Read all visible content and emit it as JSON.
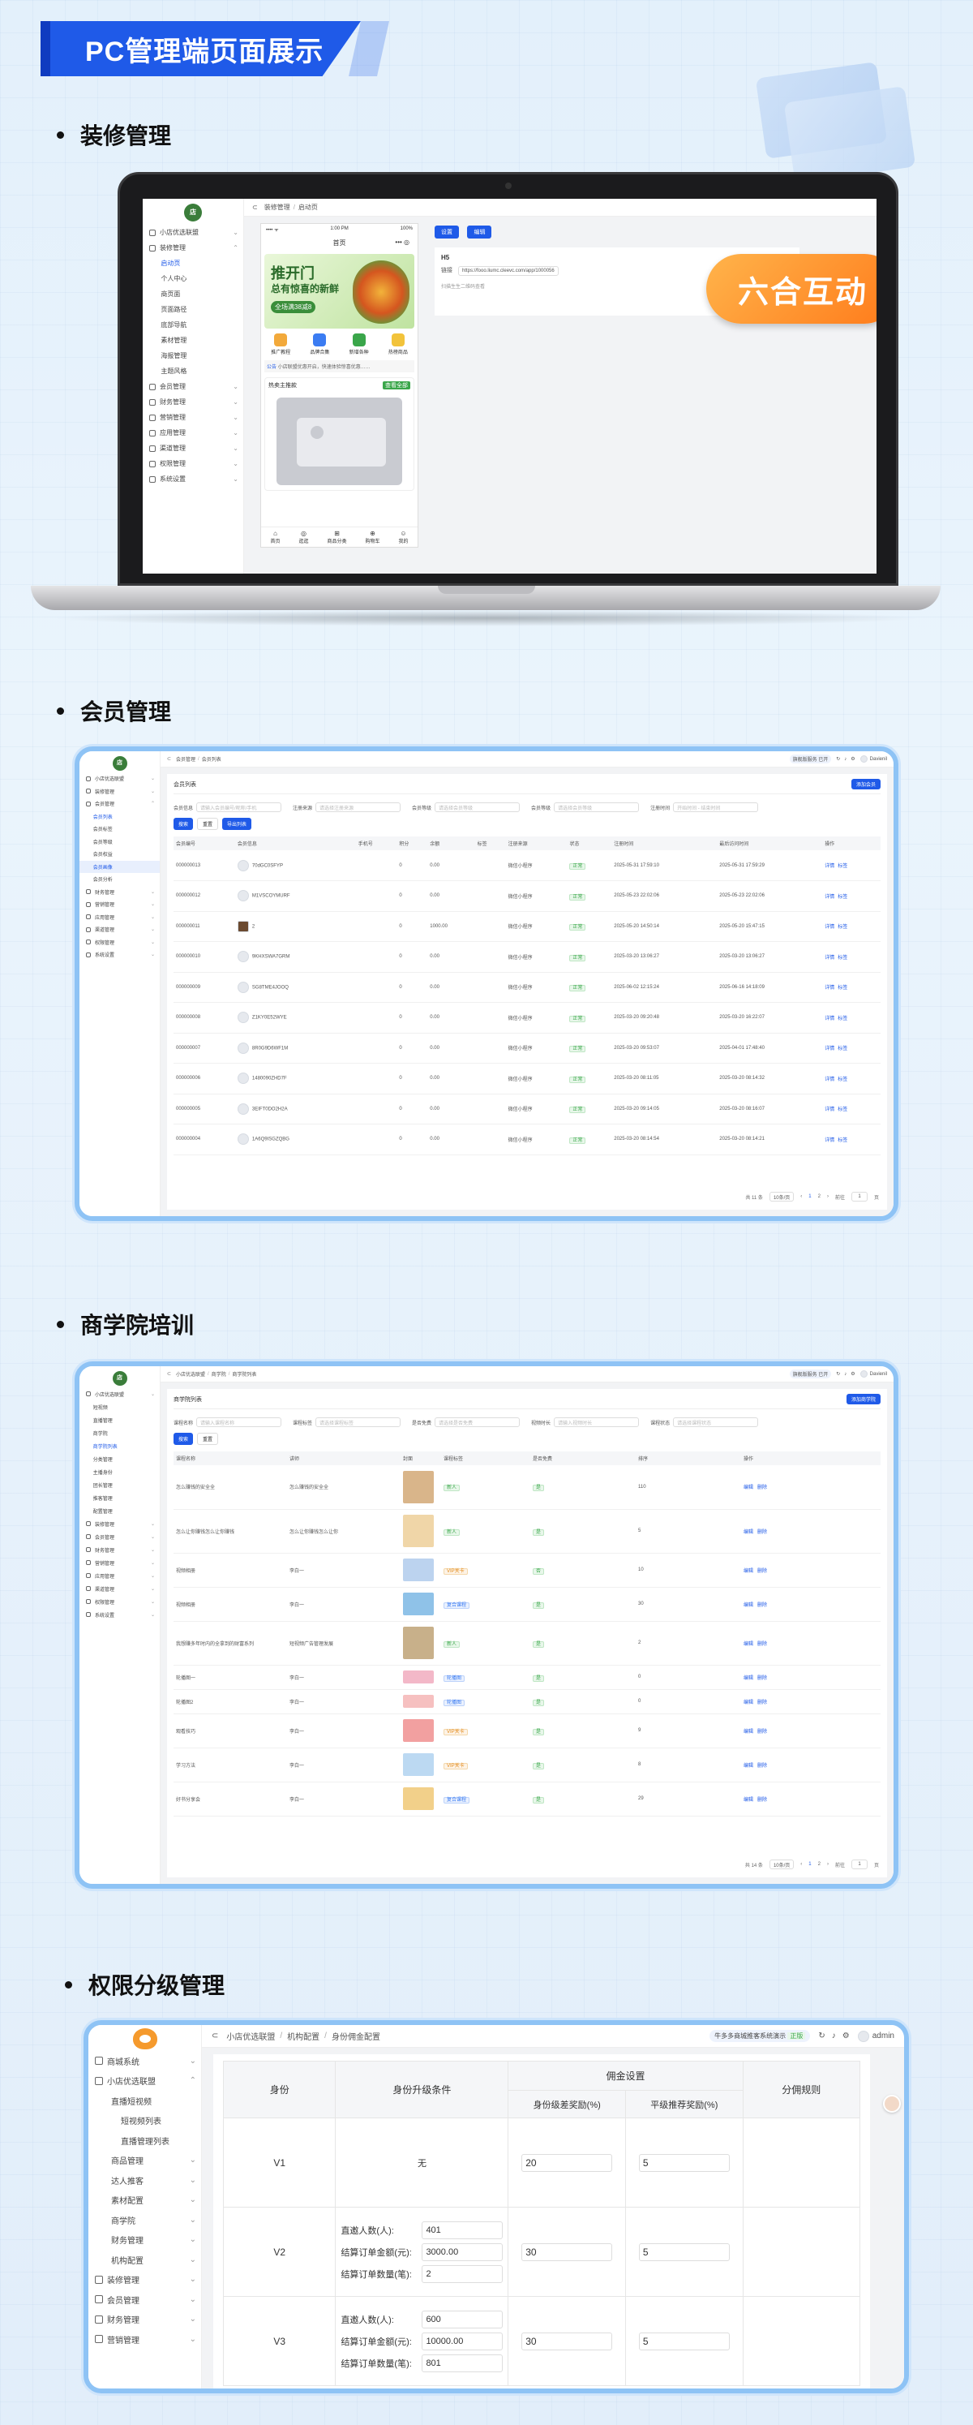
{
  "banner": {
    "title": "PC管理端页面展示"
  },
  "sections": {
    "s1": "装修管理",
    "s2": "会员管理",
    "s3": "商学院培训",
    "s4": "权限分级管理"
  },
  "decoration": {
    "breadcrumb": [
      "装修管理",
      "/",
      "启动页"
    ],
    "sidebar": [
      {
        "label": "小店优选联盟",
        "state": "parent"
      },
      {
        "label": "装修管理",
        "state": "parent-open"
      },
      {
        "label": "启动页",
        "state": "active-sub"
      },
      {
        "label": "个人中心",
        "state": "sub"
      },
      {
        "label": "商页面",
        "state": "sub"
      },
      {
        "label": "页面路径",
        "state": "sub"
      },
      {
        "label": "底部导航",
        "state": "sub"
      },
      {
        "label": "素材管理",
        "state": "sub"
      },
      {
        "label": "海报管理",
        "state": "sub"
      },
      {
        "label": "主题风格",
        "state": "sub"
      },
      {
        "label": "会员管理",
        "state": "parent"
      },
      {
        "label": "财务管理",
        "state": "parent"
      },
      {
        "label": "营销管理",
        "state": "parent"
      },
      {
        "label": "应用管理",
        "state": "parent"
      },
      {
        "label": "渠道管理",
        "state": "parent"
      },
      {
        "label": "权限管理",
        "state": "parent"
      },
      {
        "label": "系统设置",
        "state": "parent"
      }
    ],
    "phone": {
      "time": "1:00 PM",
      "battery": "100%",
      "title": "首页",
      "banner_big": "推开门",
      "banner_sub": "总有惊喜的新鲜",
      "banner_promo": "全场满38减8",
      "icons": [
        "推广教程",
        "品牌合集",
        "新增各种",
        "热榜商品"
      ],
      "notice_label": "公告",
      "notice_text": "小店联盟优惠开启，快速体验惊喜优惠……",
      "section_title": "热卖主推款",
      "section_tag": "查看全部",
      "nav": [
        "首页",
        "逛逛",
        "商品分类",
        "购物车",
        "我的"
      ]
    },
    "actions": [
      "设置",
      "编辑"
    ],
    "h5_label": "H5",
    "link_label": "链接",
    "link_value": "https://fooo.liumc.cleevc.com/app/1000056",
    "qr_label": "扫描生生二维码查看",
    "watermark": "六合互动"
  },
  "member": {
    "brand": "小店优选联盟",
    "breadcrumb": [
      "会员管理",
      "/",
      "会员列表"
    ],
    "top_badge": "旗舰版服务 已开",
    "admin": "Davienil",
    "sidebar": [
      {
        "label": "小店优选联盟",
        "state": "parent"
      },
      {
        "label": "装修管理",
        "state": "parent"
      },
      {
        "label": "会员管理",
        "state": "parent-open"
      },
      {
        "label": "会员列表",
        "state": "active-sub"
      },
      {
        "label": "会员标签",
        "state": "sub"
      },
      {
        "label": "会员等级",
        "state": "sub"
      },
      {
        "label": "会员权益",
        "state": "sub"
      },
      {
        "label": "会员画像",
        "state": "activebg"
      },
      {
        "label": "会员分析",
        "state": "sub"
      },
      {
        "label": "财务管理",
        "state": "parent"
      },
      {
        "label": "营销管理",
        "state": "parent"
      },
      {
        "label": "应用管理",
        "state": "parent"
      },
      {
        "label": "渠道管理",
        "state": "parent"
      },
      {
        "label": "权限管理",
        "state": "parent"
      },
      {
        "label": "系统设置",
        "state": "parent"
      }
    ],
    "card_title": "会员列表",
    "add_button": "添加会员",
    "filters": [
      {
        "label": "会员信息",
        "placeholder": "请输入会员编号/昵称/手机"
      },
      {
        "label": "注册来源",
        "placeholder": "请选择注册来源"
      },
      {
        "label": "会员等级",
        "placeholder": "请选择会员等级"
      },
      {
        "label": "会员等级",
        "placeholder": "请选择会员等级"
      },
      {
        "label": "注册时间",
        "placeholder": "开始时间 - 结束时间"
      }
    ],
    "buttons": [
      "搜索",
      "重置",
      "导出列表"
    ],
    "columns": [
      "会员编号",
      "会员信息",
      "手机号",
      "积分",
      "余额",
      "标签",
      "注册来源",
      "状态",
      "注册时间",
      "最后访问时间",
      "操作"
    ],
    "rows": [
      {
        "id": "000000013",
        "name": "70dGC0SFYP",
        "points": "0",
        "balance": "0.00",
        "source": "微信小程序",
        "status": "正常",
        "reg": "2025-05-31 17:59:10",
        "last": "2025-05-31 17:59:29"
      },
      {
        "id": "000000012",
        "name": "M1VSCOYMURF",
        "points": "0",
        "balance": "0.00",
        "source": "微信小程序",
        "status": "正常",
        "reg": "2025-05-23 22:02:06",
        "last": "2025-05-23 22:02:06"
      },
      {
        "id": "000000011",
        "name": "2",
        "points": "0",
        "balance": "1000.00",
        "source": "微信小程序",
        "status": "正常",
        "reg": "2025-05-20 14:50:14",
        "last": "2025-05-20 15:47:15"
      },
      {
        "id": "000000010",
        "name": "9KHXSWA7GRM",
        "points": "0",
        "balance": "0.00",
        "source": "微信小程序",
        "status": "正常",
        "reg": "2025-03-20 13:06:27",
        "last": "2025-03-20 13:06:27"
      },
      {
        "id": "000000009",
        "name": "SG8TME4JOOQ",
        "points": "0",
        "balance": "0.00",
        "source": "微信小程序",
        "status": "正常",
        "reg": "2025-06-02 12:15:24",
        "last": "2025-06-16 14:18:09"
      },
      {
        "id": "000000008",
        "name": "Z1KY0E52WYE",
        "points": "0",
        "balance": "0.00",
        "source": "微信小程序",
        "status": "正常",
        "reg": "2025-03-20 09:20:48",
        "last": "2025-03-20 16:22:07"
      },
      {
        "id": "000000007",
        "name": "8R0G9D6WF1M",
        "points": "0",
        "balance": "0.00",
        "source": "微信小程序",
        "status": "正常",
        "reg": "2025-03-20 09:53:07",
        "last": "2025-04-01 17:48:40"
      },
      {
        "id": "000000006",
        "name": "1480090ZHD7F",
        "points": "0",
        "balance": "0.00",
        "source": "微信小程序",
        "status": "正常",
        "reg": "2025-03-20 08:11:05",
        "last": "2025-03-20 08:14:32"
      },
      {
        "id": "000000005",
        "name": "3EIFT0DO2H2A",
        "points": "0",
        "balance": "0.00",
        "source": "微信小程序",
        "status": "正常",
        "reg": "2025-03-20 09:14:05",
        "last": "2025-03-20 08:16:07"
      },
      {
        "id": "000000004",
        "name": "1A6Q9ISGZQBG",
        "points": "0",
        "balance": "0.00",
        "source": "微信小程序",
        "status": "正常",
        "reg": "2025-03-20 08:14:54",
        "last": "2025-03-20 08:14:21"
      }
    ],
    "ops": [
      "详情",
      "标签"
    ],
    "pagination": {
      "total": "共 11 条",
      "size": "10条/页",
      "pages": [
        "1",
        "2"
      ],
      "goto": "前往",
      "page": "1",
      "unit": "页"
    }
  },
  "academy": {
    "breadcrumb": [
      "小店优选联盟",
      "/",
      "商学院",
      "/",
      "商学院列表"
    ],
    "top_badge": "旗舰版服务 已开",
    "admin": "Davienil",
    "sidebar": [
      {
        "label": "小店优选联盟",
        "state": "parent"
      },
      {
        "label": "短视频",
        "state": "sub"
      },
      {
        "label": "直播管理",
        "state": "sub"
      },
      {
        "label": "商学院",
        "state": "sub"
      },
      {
        "label": "商学院列表",
        "state": "active-sub"
      },
      {
        "label": "分类管理",
        "state": "sub"
      },
      {
        "label": "主播身份",
        "state": "sub"
      },
      {
        "label": "团长管理",
        "state": "sub"
      },
      {
        "label": "推客管理",
        "state": "sub"
      },
      {
        "label": "配置管理",
        "state": "sub"
      },
      {
        "label": "装修管理",
        "state": "parent"
      },
      {
        "label": "会员管理",
        "state": "parent"
      },
      {
        "label": "财务管理",
        "state": "parent"
      },
      {
        "label": "营销管理",
        "state": "parent"
      },
      {
        "label": "应用管理",
        "state": "parent"
      },
      {
        "label": "渠道管理",
        "state": "parent"
      },
      {
        "label": "权限管理",
        "state": "parent"
      },
      {
        "label": "系统设置",
        "state": "parent"
      }
    ],
    "card_title": "商学院列表",
    "add_button": "添加商学院",
    "filters": [
      {
        "label": "课程名称",
        "placeholder": "请输入课程名称"
      },
      {
        "label": "课程标签",
        "placeholder": "请选择课程标签"
      },
      {
        "label": "是否免费",
        "placeholder": "请选择是否免费"
      },
      {
        "label": "视频时长",
        "placeholder": "请输入视频时长"
      },
      {
        "label": "课程状态",
        "placeholder": "请选择课程状态"
      }
    ],
    "buttons": [
      "搜索",
      "重置"
    ],
    "columns": [
      "课程名称",
      "讲师",
      "封面",
      "课程标签",
      "是否免费",
      "排序",
      "操作"
    ],
    "rows": [
      {
        "name": "怎么赚钱的安全全",
        "lecturer": "怎么赚钱的安全全",
        "tag": "新人",
        "free": "是",
        "sort": "110",
        "ctag": "g"
      },
      {
        "name": "怎么让你赚钱怎么让你赚钱",
        "lecturer": "怎么让你赚钱怎么让你",
        "tag": "新人",
        "free": "是",
        "sort": "5",
        "ctag": "g"
      },
      {
        "name": "视频相册",
        "lecturer": "李白一",
        "tag": "VIP关卡",
        "free": "否",
        "sort": "10",
        "ctag": "o"
      },
      {
        "name": "视频相册",
        "lecturer": "李白一",
        "tag": "复合课程",
        "free": "是",
        "sort": "30",
        "ctag": "b"
      },
      {
        "name": "我想赚多年时内的全拿到的财富系列",
        "lecturer": "短视频广告管理发展",
        "tag": "新人",
        "free": "是",
        "sort": "2",
        "ctag": "g"
      },
      {
        "name": "轮播图一",
        "lecturer": "李白一",
        "tag": "轮播图",
        "free": "是",
        "sort": "0",
        "ctag": "b"
      },
      {
        "name": "轮播图2",
        "lecturer": "李白一",
        "tag": "轮播图",
        "free": "是",
        "sort": "0",
        "ctag": "b"
      },
      {
        "name": "观看技巧",
        "lecturer": "李白一",
        "tag": "VIP关卡",
        "free": "是",
        "sort": "9",
        "ctag": "o"
      },
      {
        "name": "学习方法",
        "lecturer": "李白一",
        "tag": "VIP关卡",
        "free": "是",
        "sort": "8",
        "ctag": "o"
      },
      {
        "name": "好书分享会",
        "lecturer": "李白一",
        "tag": "复合课程",
        "free": "是",
        "sort": "29",
        "ctag": "b"
      }
    ],
    "ops": [
      "编辑",
      "删除"
    ],
    "pagination": {
      "total": "共 14 条",
      "size": "10条/页",
      "pages": [
        "1",
        "2"
      ],
      "goto": "前往",
      "page": "1",
      "unit": "页"
    }
  },
  "permission": {
    "breadcrumb": [
      "小店优选联盟",
      "/",
      "机构配置",
      "/",
      "身份佣金配置"
    ],
    "top_badge": "牛多多商城推客系统演示",
    "top_badge_tag": "正版",
    "admin": "admin",
    "sidebar": [
      {
        "label": "商城系统",
        "state": "parent"
      },
      {
        "label": "小店优选联盟",
        "state": "parent-open"
      },
      {
        "label": "直播短视频",
        "state": "sub"
      },
      {
        "label": "短视频列表",
        "state": "sub2"
      },
      {
        "label": "直播管理列表",
        "state": "sub2"
      },
      {
        "label": "商品管理",
        "state": "subchev"
      },
      {
        "label": "达人推客",
        "state": "subchev"
      },
      {
        "label": "素材配置",
        "state": "subchev"
      },
      {
        "label": "商学院",
        "state": "subchev"
      },
      {
        "label": "财务管理",
        "state": "subchev"
      },
      {
        "label": "机构配置",
        "state": "subchev"
      },
      {
        "label": "装修管理",
        "state": "parent"
      },
      {
        "label": "会员管理",
        "state": "parent"
      },
      {
        "label": "财务管理",
        "state": "parent"
      },
      {
        "label": "营销管理",
        "state": "parent"
      }
    ],
    "headers": {
      "identity": "身份",
      "condition": "身份升级条件",
      "commission": "佣金设置",
      "self": "身份级差奖励(%)",
      "peer": "平级推荐奖励(%)",
      "rule": "分佣规则"
    },
    "rows": [
      {
        "level": "V1",
        "conditions": [],
        "none": "无",
        "self": "20",
        "peer": "5"
      },
      {
        "level": "V2",
        "conditions": [
          {
            "label": "直邀人数(人):",
            "value": "401"
          },
          {
            "label": "结算订单金额(元):",
            "value": "3000.00"
          },
          {
            "label": "结算订单数量(笔):",
            "value": "2"
          }
        ],
        "self": "30",
        "peer": "5"
      },
      {
        "level": "V3",
        "conditions": [
          {
            "label": "直邀人数(人):",
            "value": "600"
          },
          {
            "label": "结算订单金额(元):",
            "value": "10000.00"
          },
          {
            "label": "结算订单数量(笔):",
            "value": "801"
          }
        ],
        "self": "30",
        "peer": "5"
      }
    ]
  }
}
